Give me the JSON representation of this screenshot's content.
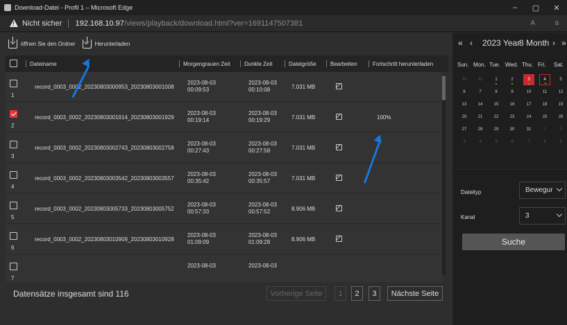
{
  "window": {
    "title": "Download-Datei - Profil 1 – Microsoft Edge",
    "minimize": "–",
    "restore": "▢",
    "close": "✕"
  },
  "address": {
    "warning": "Nicht sicher",
    "host": "192.168.10.97",
    "path": "/views/playback/download.html?ver=1691147507381",
    "read_aloud": "A",
    "translate": "a"
  },
  "toolbar": {
    "open_folder": "öffnen Sie den Ordner",
    "download": "Herunterladen"
  },
  "table": {
    "headers": [
      "Dateiname",
      "Morgengrauen Zeit",
      "Dunkle Zeit",
      "Dateigröße",
      "Bearbeiten",
      "Fortschritt herunterladen"
    ],
    "rows": [
      {
        "index": "1",
        "checked": false,
        "name": "record_0003_0002_20230803000953_20230803001008",
        "start_date": "2023-08-03",
        "start_time": "00:09:53",
        "end_date": "2023-08-03",
        "end_time": "00:10:08",
        "size": "7.031 MB",
        "progress": ""
      },
      {
        "index": "2",
        "checked": true,
        "name": "record_0003_0002_20230803001914_20230803001929",
        "start_date": "2023-08-03",
        "start_time": "00:19:14",
        "end_date": "2023-08-03",
        "end_time": "00:19:29",
        "size": "7.031 MB",
        "progress": "100%"
      },
      {
        "index": "3",
        "checked": false,
        "name": "record_0003_0002_20230803002743_20230803002758",
        "start_date": "2023-08-03",
        "start_time": "00:27:43",
        "end_date": "2023-08-03",
        "end_time": "00:27:58",
        "size": "7.031 MB",
        "progress": ""
      },
      {
        "index": "4",
        "checked": false,
        "name": "record_0003_0002_20230803003542_20230803003557",
        "start_date": "2023-08-03",
        "start_time": "00:35:42",
        "end_date": "2023-08-03",
        "end_time": "00:35:57",
        "size": "7.031 MB",
        "progress": ""
      },
      {
        "index": "5",
        "checked": false,
        "name": "record_0003_0002_20230803005733_20230803005752",
        "start_date": "2023-08-03",
        "start_time": "00:57:33",
        "end_date": "2023-08-03",
        "end_time": "00:57:52",
        "size": "8.906 MB",
        "progress": ""
      },
      {
        "index": "6",
        "checked": false,
        "name": "record_0003_0002_20230803010909_20230803010928",
        "start_date": "2023-08-03",
        "start_time": "01:09:09",
        "end_date": "2023-08-03",
        "end_time": "01:09:28",
        "size": "8.906 MB",
        "progress": ""
      },
      {
        "index": "7",
        "checked": false,
        "name": "",
        "start_date": "2023-08-03",
        "start_time": "",
        "end_date": "2023-08-03",
        "end_time": "",
        "size": "",
        "progress": ""
      }
    ]
  },
  "footer": {
    "total": "Datensätze insgesamt sind 116",
    "prev": "Vorherige Seite",
    "pages": [
      "1",
      "2",
      "3"
    ],
    "current_page": "2",
    "next": "Nächste Seite"
  },
  "calendar": {
    "year": "2023 Year",
    "month": "8 Month",
    "nav": {
      "prev_year": "«",
      "prev_month": "‹",
      "next_month": "›",
      "next_year": "»"
    },
    "weekdays": [
      "Sun.",
      "Mon.",
      "Tue.",
      "Wed.",
      "Thu.",
      "Fri.",
      "Sat."
    ],
    "weeks": [
      [
        {
          "d": "30",
          "m": true
        },
        {
          "d": "31",
          "m": true
        },
        {
          "d": "1",
          "dot": true
        },
        {
          "d": "2",
          "dot": true
        },
        {
          "d": "3",
          "rec": true,
          "dot": true
        },
        {
          "d": "4",
          "recout": true,
          "dot": true
        },
        {
          "d": "5"
        }
      ],
      [
        {
          "d": "6"
        },
        {
          "d": "7"
        },
        {
          "d": "8"
        },
        {
          "d": "9"
        },
        {
          "d": "10"
        },
        {
          "d": "11"
        },
        {
          "d": "12"
        }
      ],
      [
        {
          "d": "13"
        },
        {
          "d": "14"
        },
        {
          "d": "15"
        },
        {
          "d": "16"
        },
        {
          "d": "17"
        },
        {
          "d": "18"
        },
        {
          "d": "19"
        }
      ],
      [
        {
          "d": "20"
        },
        {
          "d": "21"
        },
        {
          "d": "22"
        },
        {
          "d": "23"
        },
        {
          "d": "24"
        },
        {
          "d": "25"
        },
        {
          "d": "26"
        }
      ],
      [
        {
          "d": "27"
        },
        {
          "d": "28"
        },
        {
          "d": "29"
        },
        {
          "d": "30"
        },
        {
          "d": "31"
        },
        {
          "d": "1",
          "m": true
        },
        {
          "d": "2",
          "m": true
        }
      ],
      [
        {
          "d": "3",
          "m": true
        },
        {
          "d": "4",
          "m": true
        },
        {
          "d": "5",
          "m": true
        },
        {
          "d": "6",
          "m": true
        },
        {
          "d": "7",
          "m": true
        },
        {
          "d": "8",
          "m": true
        },
        {
          "d": "9",
          "m": true
        }
      ]
    ]
  },
  "filters": {
    "filetype_label": "Dateityp",
    "filetype_value": "Bewegur",
    "channel_label": "Kanal",
    "channel_value": "3",
    "search": "Suche"
  },
  "colors": {
    "accent_red": "#c62b33",
    "annotation_blue": "#1677e0",
    "record_dot": "#3cd43c"
  }
}
